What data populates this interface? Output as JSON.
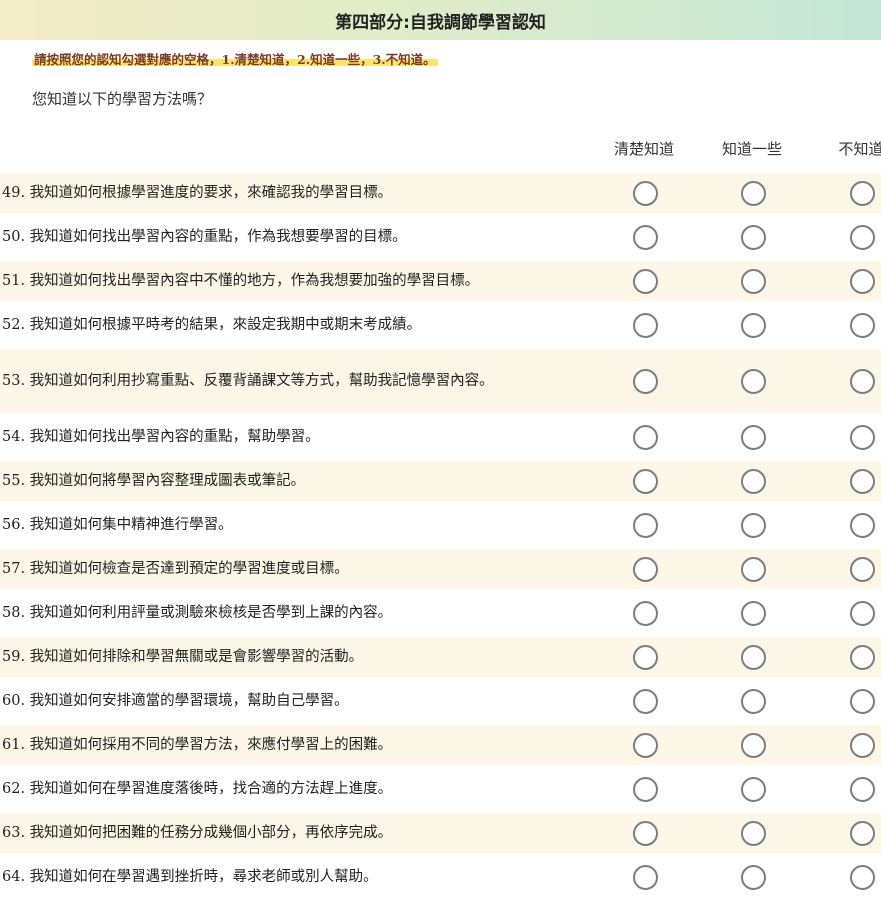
{
  "header": {
    "title": "第四部分:自我調節學習認知"
  },
  "instruction": "請按照您的認知勾選對應的空格，1.清楚知道，2.知道一些，3.不知道。",
  "question": "您知道以下的學習方法嗎？",
  "columns": [
    "清楚知道",
    "知道一些",
    "不知道"
  ],
  "items": [
    {
      "text": "49. 我知道如何根據學習進度的要求，來確認我的學習目標。",
      "selected": null
    },
    {
      "text": "50. 我知道如何找出學習內容的重點，作為我想要學習的目標。",
      "selected": null
    },
    {
      "text": "51. 我知道如何找出學習內容中不懂的地方，作為我想要加強的學習目標。",
      "selected": null
    },
    {
      "text": "52. 我知道如何根據平時考的結果，來設定我期中或期末考成績。",
      "selected": null
    },
    {
      "text": "53. 我知道如何利用抄寫重點、反覆背誦課文等方式，幫助我記憶學習內容。",
      "selected": null
    },
    {
      "text": "54. 我知道如何找出學習內容的重點，幫助學習。",
      "selected": null
    },
    {
      "text": "55. 我知道如何將學習內容整理成圖表或筆記。",
      "selected": null
    },
    {
      "text": "56. 我知道如何集中精神進行學習。",
      "selected": null
    },
    {
      "text": "57. 我知道如何檢查是否達到預定的學習進度或目標。",
      "selected": null
    },
    {
      "text": "58. 我知道如何利用評量或測驗來檢核是否學到上課的內容。",
      "selected": null
    },
    {
      "text": "59. 我知道如何排除和學習無關或是會影響學習的活動。",
      "selected": null
    },
    {
      "text": "60. 我知道如何安排適當的學習環境，幫助自己學習。",
      "selected": null
    },
    {
      "text": "61. 我知道如何採用不同的學習方法，來應付學習上的困難。",
      "selected": null
    },
    {
      "text": "62. 我知道如何在學習進度落後時，找合適的方法趕上進度。",
      "selected": null
    },
    {
      "text": "63. 我知道如何把困難的任務分成幾個小部分，再依序完成。",
      "selected": null
    },
    {
      "text": "64. 我知道如何在學習遇到挫折時，尋求老師或別人幫助。",
      "selected": null
    }
  ]
}
